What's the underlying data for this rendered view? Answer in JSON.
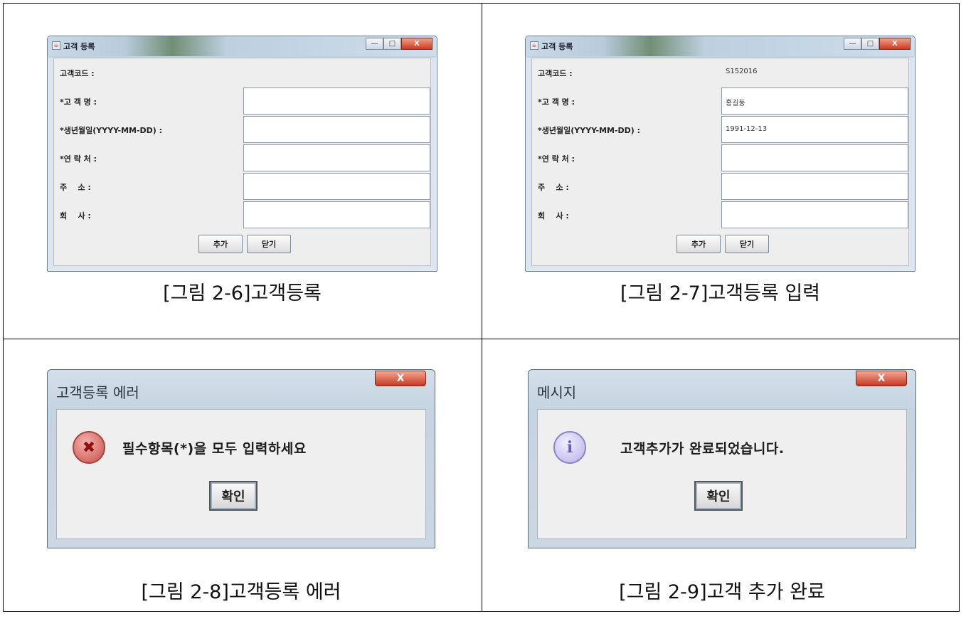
{
  "panels": {
    "fig6": {
      "window_title": "고객 등록",
      "fields": [
        {
          "label": "고객코드 :",
          "value": ""
        },
        {
          "label": "*고 객 명 :",
          "value": ""
        },
        {
          "label": "*생년월일(YYYY-MM-DD) :",
          "value": ""
        },
        {
          "label": "*연 락 처 :",
          "value": ""
        },
        {
          "label": "주    소 :",
          "value": ""
        },
        {
          "label": "회    사 :",
          "value": ""
        }
      ],
      "add_label": "추가",
      "close_label": "닫기",
      "caption": "[그림 2-6]고객등록"
    },
    "fig7": {
      "window_title": "고객 등록",
      "fields": [
        {
          "label": "고객코드 :",
          "value": "S152016"
        },
        {
          "label": "*고 객 명 :",
          "value": "홍길동"
        },
        {
          "label": "*생년월일(YYYY-MM-DD) :",
          "value": "1991-12-13"
        },
        {
          "label": "*연 락 처 :",
          "value": ""
        },
        {
          "label": "주    소 :",
          "value": ""
        },
        {
          "label": "회    사 :",
          "value": ""
        }
      ],
      "add_label": "추가",
      "close_label": "닫기",
      "caption": "[그림 2-7]고객등록 입력"
    },
    "fig8": {
      "dialog_title": "고객등록 에러",
      "message": "필수항목(*)을 모두 입력하세요",
      "ok_label": "확인",
      "caption": "[그림 2-8]고객등록 에러"
    },
    "fig9": {
      "dialog_title": "메시지",
      "message": "고객추가가 완료되었습니다.",
      "ok_label": "확인",
      "caption": "[그림 2-9]고객 추가 완료"
    }
  },
  "window_controls": {
    "minimize": "—",
    "maximize": "□",
    "close": "X"
  }
}
